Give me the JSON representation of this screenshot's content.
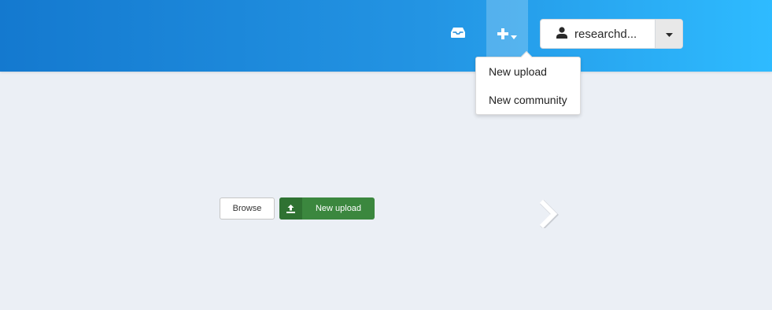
{
  "header": {
    "inbox_icon": "inbox-icon",
    "plus_icon": "plus-icon",
    "user_icon": "user-icon",
    "username": "researchd...",
    "caret_icon": "caret-down-icon",
    "colors": {
      "gradient_start": "#1479cf",
      "gradient_end": "#2ebbff"
    }
  },
  "dropdown": {
    "items": [
      {
        "label": "New upload"
      },
      {
        "label": "New community"
      }
    ]
  },
  "main": {
    "browse_label": "Browse",
    "new_upload_label": "New upload",
    "upload_icon": "upload-icon",
    "next_icon": "chevron-right-icon",
    "colors": {
      "upload_button": "#3b873e"
    }
  }
}
